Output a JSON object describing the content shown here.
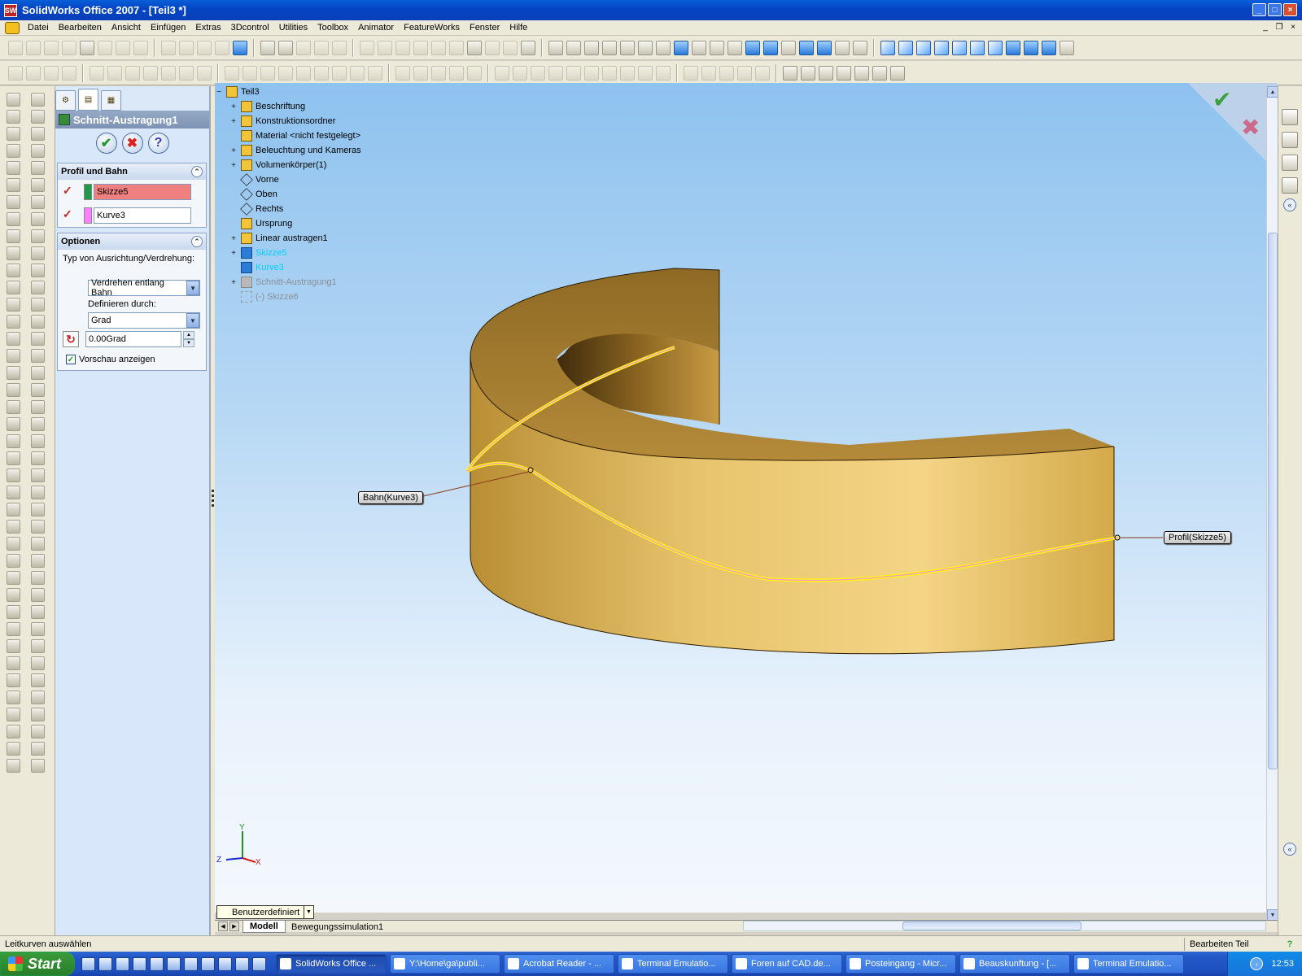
{
  "window": {
    "title": "SolidWorks Office 2007 - [Teil3 *]",
    "app_badge": "SW"
  },
  "menu": [
    "Datei",
    "Bearbeiten",
    "Ansicht",
    "Einfügen",
    "Extras",
    "3Dcontrol",
    "Utilities",
    "Toolbox",
    "Animator",
    "FeatureWorks",
    "Fenster",
    "Hilfe"
  ],
  "property_manager": {
    "title": "Schnitt-Austragung1",
    "group_profile": {
      "title": "Profil und Bahn",
      "profile_value": "Skizze5",
      "path_value": "Kurve3",
      "profile_color": "#1e9a4a",
      "path_color": "#ff80ff",
      "active_color": "#f08080"
    },
    "group_options": {
      "title": "Optionen",
      "orientation_label": "Typ von Ausrichtung/Verdrehung:",
      "orientation_value": "Verdrehen entlang Bahn",
      "define_label": "Definieren durch:",
      "define_value": "Grad",
      "angle_value": "0.00Grad",
      "preview_label": "Vorschau anzeigen",
      "preview_checked": true
    }
  },
  "feature_tree": [
    {
      "label": "Teil3",
      "expander": "-",
      "icon": "part",
      "style": "normal"
    },
    {
      "label": "Beschriftung",
      "expander": "+",
      "icon": "annotation",
      "style": "normal"
    },
    {
      "label": "Konstruktionsordner",
      "expander": "+",
      "icon": "design-binder",
      "style": "normal"
    },
    {
      "label": "Material <nicht festgelegt>",
      "expander": "",
      "icon": "material",
      "style": "normal"
    },
    {
      "label": "Beleuchtung und Kameras",
      "expander": "+",
      "icon": "lights",
      "style": "normal"
    },
    {
      "label": "Volumenkörper(1)",
      "expander": "+",
      "icon": "solid-bodies",
      "style": "normal"
    },
    {
      "label": "Vorne",
      "expander": "",
      "icon": "plane",
      "style": "normal"
    },
    {
      "label": "Oben",
      "expander": "",
      "icon": "plane",
      "style": "normal"
    },
    {
      "label": "Rechts",
      "expander": "",
      "icon": "plane",
      "style": "normal"
    },
    {
      "label": "Ursprung",
      "expander": "",
      "icon": "origin",
      "style": "normal"
    },
    {
      "label": "Linear austragen1",
      "expander": "+",
      "icon": "extrude",
      "style": "normal"
    },
    {
      "label": "Skizze5",
      "expander": "+",
      "icon": "sketch",
      "style": "cyan"
    },
    {
      "label": "Kurve3",
      "expander": "",
      "icon": "curve",
      "style": "cyan"
    },
    {
      "label": "Schnitt-Austragung1",
      "expander": "+",
      "icon": "sweep-cut",
      "style": "dimmed"
    },
    {
      "label": "(-) Skizze6",
      "expander": "",
      "icon": "sketch",
      "style": "dimmed"
    }
  ],
  "callouts": {
    "path": "Bahn(Kurve3)",
    "profile": "Profil(Skizze5)"
  },
  "triad": {
    "y": "Y",
    "z": "Z",
    "x": "X"
  },
  "view_selector": "Benutzerdefiniert",
  "model_tabs": [
    "Modell",
    "Bewegungssimulation1"
  ],
  "status": {
    "message": "Leitkurven auswählen",
    "mode": "Bearbeiten Teil"
  },
  "taskbar": {
    "start": "Start",
    "tasks": [
      "SolidWorks Office ...",
      "Y:\\Home\\ga\\publi...",
      "Acrobat Reader - ...",
      "Terminal Emulatio...",
      "Foren auf CAD.de...",
      "Posteingang - Micr...",
      "Beauskunftung - [...",
      "Terminal Emulatio..."
    ],
    "clock": "12:53"
  },
  "colors": {
    "model_face": "#d7b04a",
    "preview_curve": "#ffff00",
    "selection_pink": "#ff99cc"
  }
}
